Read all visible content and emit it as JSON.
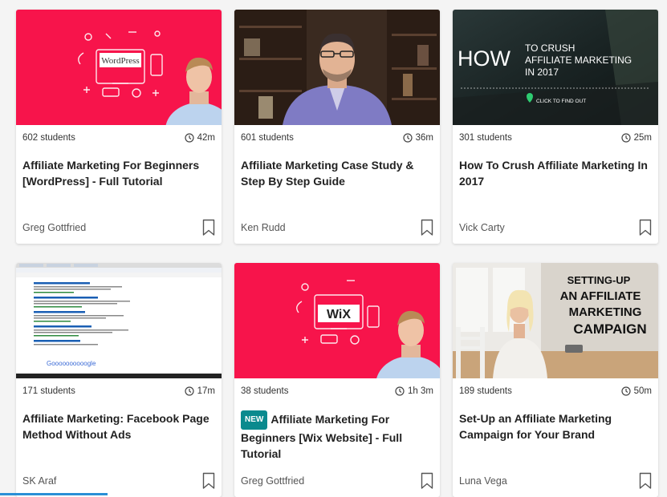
{
  "cards": [
    {
      "students": "602 students",
      "duration": "42m",
      "title": "Affiliate Marketing For Beginners [WordPress] - Full Tutorial",
      "author": "Greg Gottfried",
      "badge": "",
      "thumb_text": "WordPress",
      "thumb_bg": "#f7144b"
    },
    {
      "students": "601 students",
      "duration": "36m",
      "title": "Affiliate Marketing Case Study & Step By Step Guide",
      "author": "Ken Rudd",
      "badge": "",
      "thumb_bg": "#3a2a20"
    },
    {
      "students": "301 students",
      "duration": "25m",
      "title": "How To Crush Affiliate Marketing In 2017",
      "author": "Vick Carty",
      "badge": "",
      "thumb_big": "HOW",
      "thumb_line1": "TO CRUSH",
      "thumb_line2": "AFFILIATE MARKETING",
      "thumb_line3": "IN 2017",
      "thumb_cta": "CLICK TO FIND OUT",
      "thumb_bg": "#1f2a2a"
    },
    {
      "students": "171 students",
      "duration": "17m",
      "title": "Affiliate Marketing: Facebook Page Method Without Ads",
      "author": "SK Araf",
      "badge": "",
      "thumb_logo": "Goooooooooogle",
      "thumb_bg": "#ffffff"
    },
    {
      "students": "38 students",
      "duration": "1h 3m",
      "title": "Affiliate Marketing For Beginners [Wix Website] - Full Tutorial",
      "author": "Greg Gottfried",
      "badge": "NEW",
      "thumb_text": "WiX",
      "thumb_bg": "#f7144b"
    },
    {
      "students": "189 students",
      "duration": "50m",
      "title": "Set-Up an Affiliate Marketing Campaign for Your Brand",
      "author": "Luna Vega",
      "badge": "",
      "thumb_line1": "SETTING-UP",
      "thumb_line2": "AN AFFILIATE",
      "thumb_line3": "MARKETING",
      "thumb_line4": "CAMPAIGN",
      "thumb_bg": "#d9d4cc"
    }
  ],
  "colors": {
    "accent_pink": "#f7144b",
    "badge_teal": "#0a8a8e",
    "cta_green": "#2ecc71"
  }
}
